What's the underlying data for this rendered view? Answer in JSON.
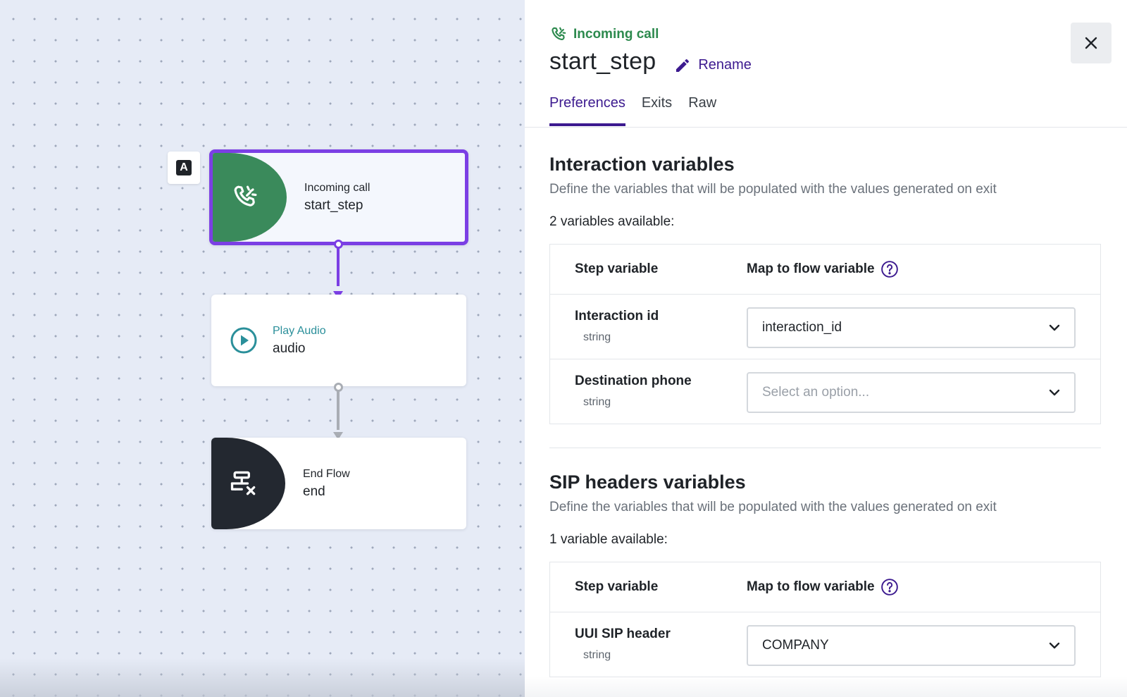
{
  "canvas": {
    "marker_label": "A",
    "nodes": [
      {
        "type": "Incoming call",
        "name": "start_step",
        "icon": "incoming-call-icon",
        "color": "#3a8a5b"
      },
      {
        "type": "Play Audio",
        "name": "audio",
        "icon": "play-circle-icon",
        "color": "#2a8f9a"
      },
      {
        "type": "End Flow",
        "name": "end",
        "icon": "end-flow-icon",
        "color": "#232830"
      }
    ],
    "accent": "#7b3fe4"
  },
  "panel": {
    "step_type": "Incoming call",
    "step_name": "start_step",
    "rename_label": "Rename",
    "tabs": [
      "Preferences",
      "Exits",
      "Raw"
    ],
    "active_tab": "Preferences",
    "interaction": {
      "title": "Interaction variables",
      "description": "Define the variables that will be populated with the values generated on exit",
      "count_text": "2 variables available:",
      "col_step": "Step variable",
      "col_map": "Map to flow variable",
      "rows": [
        {
          "name": "Interaction id",
          "type": "string",
          "value": "interaction_id",
          "placeholder": ""
        },
        {
          "name": "Destination phone",
          "type": "string",
          "value": "",
          "placeholder": "Select an option..."
        }
      ]
    },
    "sip": {
      "title": "SIP headers variables",
      "description": "Define the variables that will be populated with the values generated on exit",
      "count_text": "1 variable available:",
      "col_step": "Step variable",
      "col_map": "Map to flow variable",
      "rows": [
        {
          "name": "UUI SIP header",
          "type": "string",
          "value": "COMPANY"
        }
      ]
    },
    "colors": {
      "brand": "#3c1a8f",
      "success": "#2d8a4e"
    }
  }
}
